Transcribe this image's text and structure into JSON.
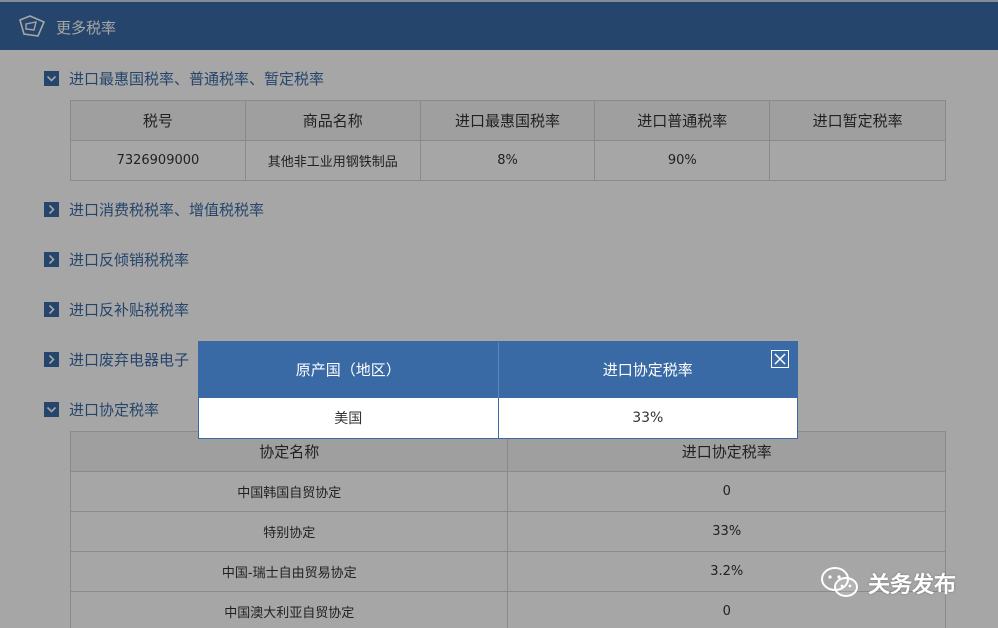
{
  "header": {
    "title": "更多税率"
  },
  "sections": {
    "import_mfn": {
      "label": "进口最惠国税率、普通税率、暂定税率"
    },
    "consumption_vat": {
      "label": "进口消费税税率、增值税税率"
    },
    "anti_dumping": {
      "label": "进口反倾销税税率"
    },
    "countervailing": {
      "label": "进口反补贴税税率"
    },
    "waste_electronics": {
      "label": "进口废弃电器电子"
    },
    "agreement": {
      "label": "进口协定税率"
    }
  },
  "rate_table": {
    "headers": [
      "税号",
      "商品名称",
      "进口最惠国税率",
      "进口普通税率",
      "进口暂定税率"
    ],
    "rows": [
      [
        "7326909000",
        "其他非工业用钢铁制品",
        "8%",
        "90%",
        ""
      ]
    ]
  },
  "agreement_table": {
    "headers": [
      "协定名称",
      "进口协定税率"
    ],
    "rows": [
      [
        "中国韩国自贸协定",
        "0"
      ],
      [
        "特别协定",
        "33%"
      ],
      [
        "中国-瑞士自由贸易协定",
        "3.2%"
      ],
      [
        "中国澳大利亚自贸协定",
        "0"
      ]
    ]
  },
  "modal": {
    "headers": [
      "原产国（地区）",
      "进口协定税率"
    ],
    "row": [
      "美国",
      "33%"
    ]
  },
  "watermark": {
    "text": "关务发布"
  },
  "colors": {
    "primary": "#3a6aa6",
    "header_bg": "#3a6aa6"
  }
}
